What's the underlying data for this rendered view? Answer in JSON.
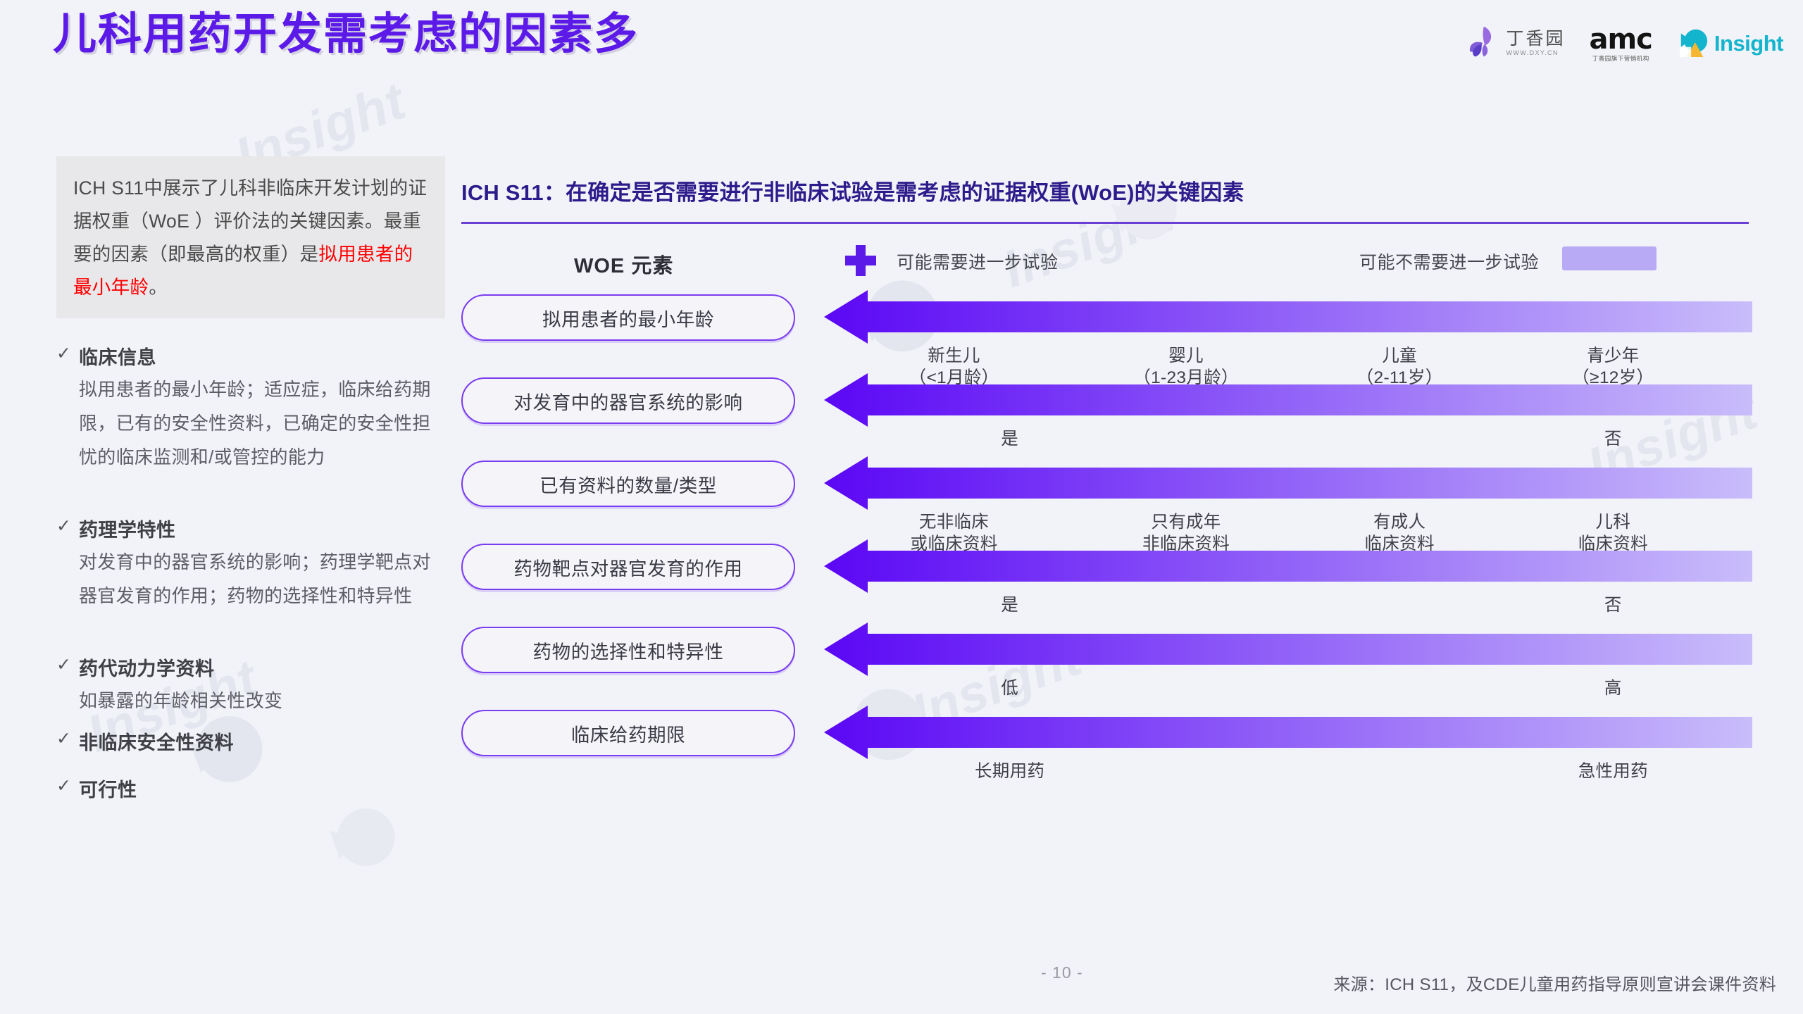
{
  "header": {
    "title": "儿科用药开发需考虑的因素多",
    "title_color": "#5b1ae8",
    "logos": [
      {
        "name": "dxy",
        "cn": "丁香园",
        "url": "WWW.DXY.CN"
      },
      {
        "name": "amc",
        "main": "amc",
        "sub": "丁香园旗下营销机构"
      },
      {
        "name": "insight",
        "text": "Insight"
      }
    ]
  },
  "sidebar": {
    "intro": {
      "part1": "ICH S11中展示了儿科非临床开发计划的证据权重（WoE ）评价法的关键因素。最重要的因素（即最高的权重）是",
      "highlight": "拟用患者的最小年龄",
      "part2": "。"
    },
    "tick_glyph": "✓",
    "blocks": [
      {
        "title": "临床信息",
        "body": "拟用患者的最小年龄；适应症，临床给药期限，已有的安全性资料，已确定的安全性担忧的临床监测和/或管控的能力"
      },
      {
        "title": "药理学特性",
        "body": "对发育中的器官系统的影响；药理学靶点对器官发育的作用；药物的选择性和特异性"
      },
      {
        "title": "药代动力学资料",
        "body": "如暴露的年龄相关性改变"
      },
      {
        "title": "非临床安全性资料",
        "body": ""
      },
      {
        "title": "可行性",
        "body": ""
      }
    ]
  },
  "main": {
    "panel_title": "ICH S11：在确定是否需要进行非临床试验是需考虑的证据权重(WoE)的关键因素",
    "legend": {
      "woe_label": "WOE 元素",
      "plus_icon": "plus-icon",
      "left_label": "可能需要进一步试验",
      "right_label": "可能不需要进一步试验",
      "chip_color": "#b9aaf5"
    },
    "arrow_gradient": {
      "from": "#5b07f5",
      "to": "#c9bdfa"
    },
    "rows": [
      {
        "label": "拟用患者的最小年龄",
        "ticks": [
          {
            "pos": 14,
            "lines": [
              "新生儿",
              "（<1月龄）"
            ]
          },
          {
            "pos": 39,
            "lines": [
              "婴儿",
              "（1-23月龄）"
            ]
          },
          {
            "pos": 62,
            "lines": [
              "儿童",
              "（2-11岁）"
            ]
          },
          {
            "pos": 85,
            "lines": [
              "青少年",
              "（≥12岁）"
            ]
          }
        ]
      },
      {
        "label": "对发育中的器官系统的影响",
        "ticks": [
          {
            "pos": 20,
            "lines": [
              "是"
            ]
          },
          {
            "pos": 85,
            "lines": [
              "否"
            ]
          }
        ]
      },
      {
        "label": "已有资料的数量/类型",
        "ticks": [
          {
            "pos": 14,
            "lines": [
              "无非临床",
              "或临床资料"
            ]
          },
          {
            "pos": 39,
            "lines": [
              "只有成年",
              "非临床资料"
            ]
          },
          {
            "pos": 62,
            "lines": [
              "有成人",
              "临床资料"
            ]
          },
          {
            "pos": 85,
            "lines": [
              "儿科",
              "临床资料"
            ]
          }
        ]
      },
      {
        "label": "药物靶点对器官发育的作用",
        "ticks": [
          {
            "pos": 20,
            "lines": [
              "是"
            ]
          },
          {
            "pos": 85,
            "lines": [
              "否"
            ]
          }
        ]
      },
      {
        "label": "药物的选择性和特异性",
        "ticks": [
          {
            "pos": 20,
            "lines": [
              "低"
            ]
          },
          {
            "pos": 85,
            "lines": [
              "高"
            ]
          }
        ]
      },
      {
        "label": "临床给药期限",
        "ticks": [
          {
            "pos": 20,
            "lines": [
              "长期用药"
            ]
          },
          {
            "pos": 85,
            "lines": [
              "急性用药"
            ]
          }
        ]
      }
    ]
  },
  "footer": {
    "page_number": "- 10 -",
    "source": "来源：ICH S11，及CDE儿童用药指导原则宣讲会课件资料"
  },
  "watermark": {
    "text": "Insight"
  }
}
